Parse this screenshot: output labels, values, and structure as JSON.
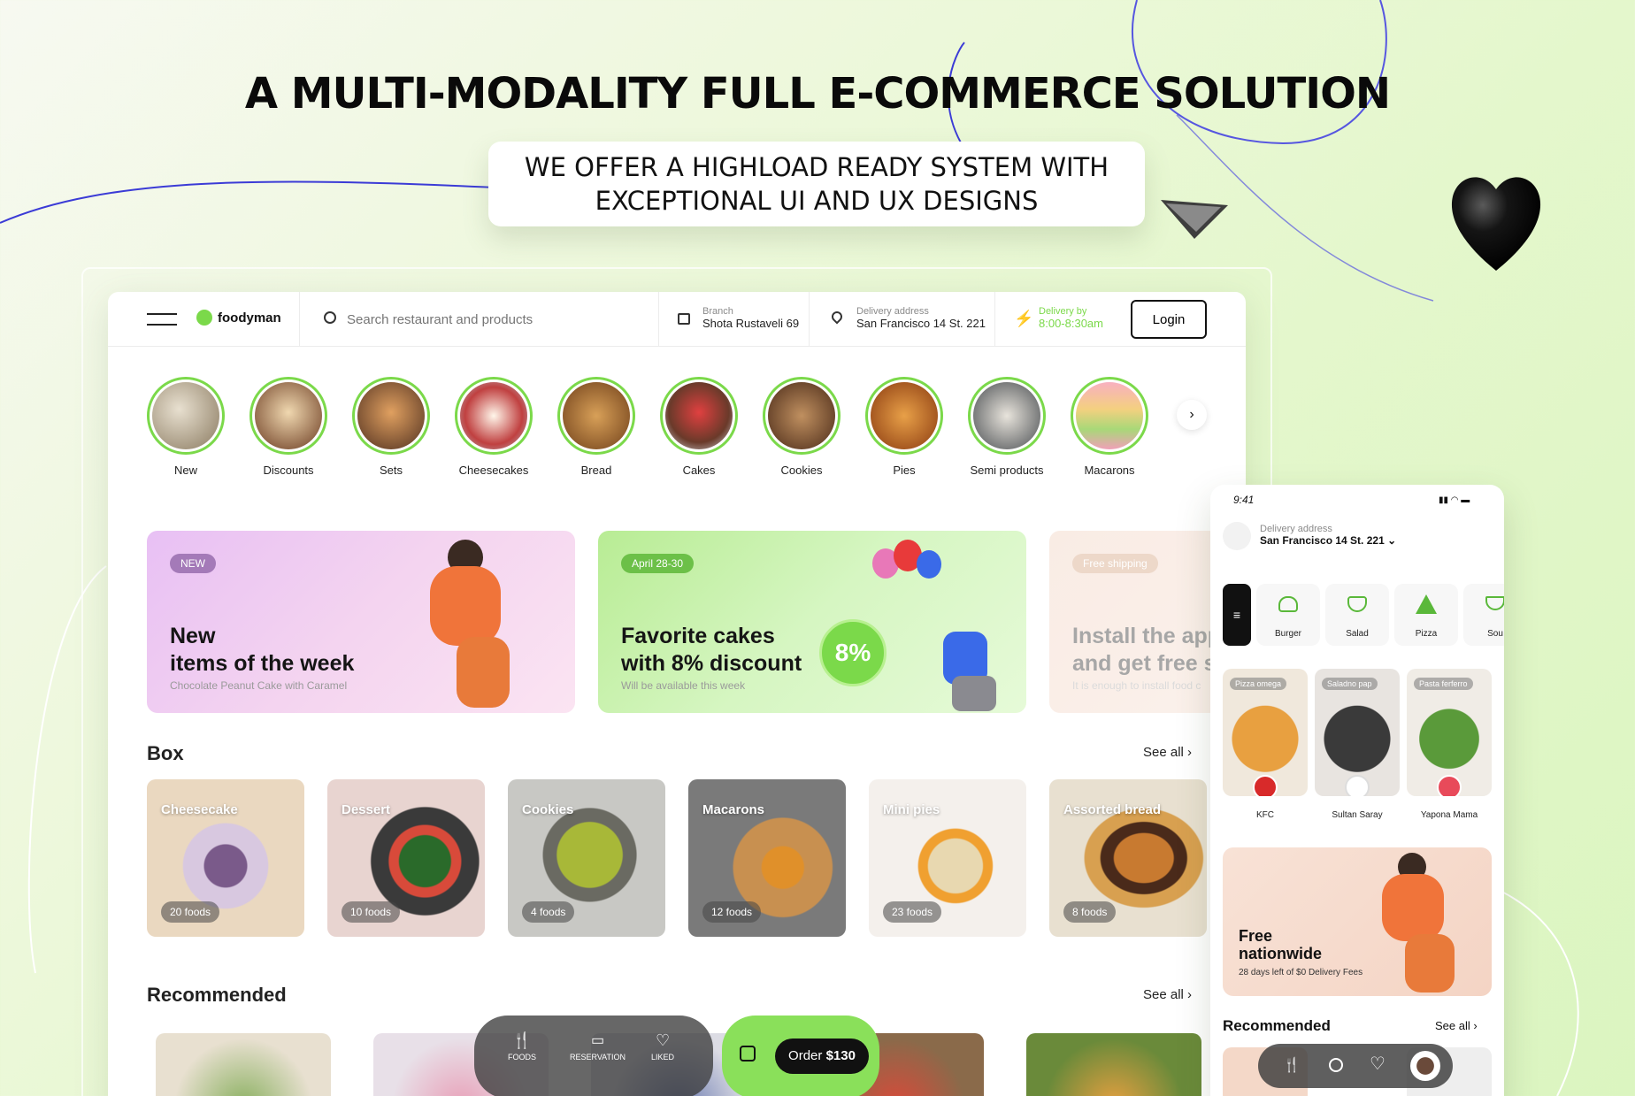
{
  "hero": {
    "title": "A MULTI-MODALITY FULL E-COMMERCE SOLUTION",
    "subtitle_line1": "WE OFFER A HIGHLOAD READY SYSTEM WITH",
    "subtitle_line2": "EXCEPTIONAL UI AND UX DESIGNS"
  },
  "header": {
    "logo": "foodyman",
    "search_placeholder": "Search restaurant and products",
    "branch_label": "Branch",
    "branch_value": "Shota Rustaveli 69",
    "delivery_address_label": "Delivery address",
    "delivery_address_value": "San Francisco 14 St. 221",
    "delivery_by_label": "Delivery by",
    "delivery_by_value": "8:00-8:30am",
    "login": "Login"
  },
  "categories": [
    "New",
    "Discounts",
    "Sets",
    "Cheesecakes",
    "Bread",
    "Cakes",
    "Cookies",
    "Pies",
    "Semi products",
    "Macarons"
  ],
  "banners": [
    {
      "pill": "NEW",
      "title1": "New",
      "title2": "items of the week",
      "sub": "Chocolate Peanut Cake with Caramel"
    },
    {
      "pill": "April 28-30",
      "title1": "Favorite cakes",
      "title2": "with 8% discount",
      "sub": "Will be available this week",
      "badge": "8%"
    },
    {
      "pill": "Free shipping",
      "title1": "Install the app",
      "title2": "and get free sh",
      "sub": "It is enough to install food c"
    }
  ],
  "box_section": {
    "title": "Box",
    "see_all": "See all"
  },
  "boxes": [
    {
      "title": "Cheesecake",
      "count": "20 foods"
    },
    {
      "title": "Dessert",
      "count": "10 foods"
    },
    {
      "title": "Cookies",
      "count": "4 foods"
    },
    {
      "title": "Macarons",
      "count": "12 foods"
    },
    {
      "title": "Mini pies",
      "count": "23 foods"
    },
    {
      "title": "Assorted bread",
      "count": "8 foods"
    }
  ],
  "recommended": {
    "title": "Recommended",
    "see_all": "See all"
  },
  "bottom_nav": {
    "foods": "FOODS",
    "reservation": "RESERVATION",
    "liked": "LIKED",
    "order_prefix": "Order",
    "order_amount": "$130"
  },
  "phone": {
    "time": "9:41",
    "delivery_label": "Delivery address",
    "delivery_value": "San Francisco 14 St. 221",
    "categories": [
      "Burger",
      "Salad",
      "Pizza",
      "Sou"
    ],
    "restaurants": [
      {
        "tag": "Pizza omega",
        "name": "KFC"
      },
      {
        "tag": "Saladno pap",
        "name": "Sultan Saray"
      },
      {
        "tag": "Pasta ferferro",
        "name": "Yapona Mama"
      }
    ],
    "promo_title1": "Free",
    "promo_title2": "nationwide",
    "promo_sub": "28 days left of $0 Delivery Fees",
    "recommended": "Recommended",
    "see_all": "See all"
  },
  "colors": {
    "accent": "#7bd94a",
    "dark": "#111111"
  }
}
